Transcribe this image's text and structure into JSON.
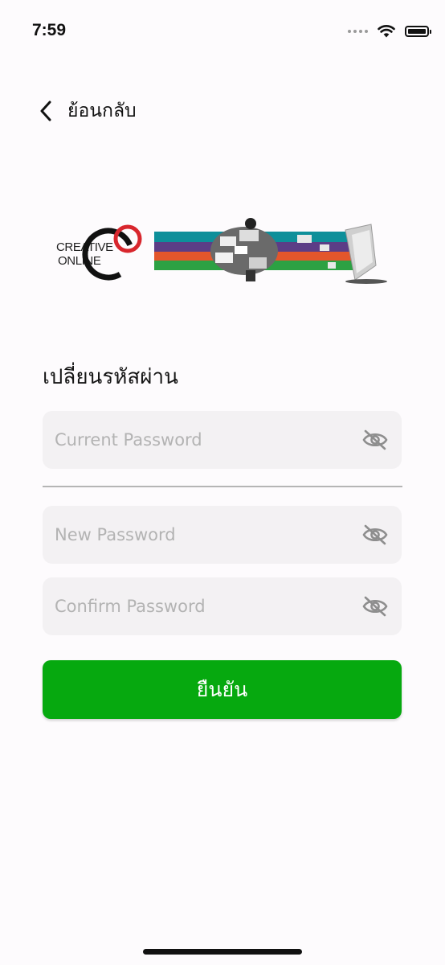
{
  "status_bar": {
    "time": "7:59"
  },
  "nav": {
    "back_label": "ย้อนกลับ"
  },
  "banner": {
    "logo_line1": "CREATIVE",
    "logo_line2": "ONLINE"
  },
  "form": {
    "title": "เปลี่ยนรหัสผ่าน",
    "current_password": {
      "placeholder": "Current Password",
      "value": "",
      "toggle_icon": "eye-off-icon"
    },
    "new_password": {
      "placeholder": "New Password",
      "value": "",
      "toggle_icon": "eye-off-icon"
    },
    "confirm_password": {
      "placeholder": "Confirm Password",
      "value": "",
      "toggle_icon": "eye-off-icon"
    },
    "submit_label": "ยืนยัน"
  },
  "colors": {
    "accent": "#06a90f",
    "background": "#fdfbfd",
    "field_background": "#f3f1f3",
    "logo_red": "#d8262d"
  }
}
